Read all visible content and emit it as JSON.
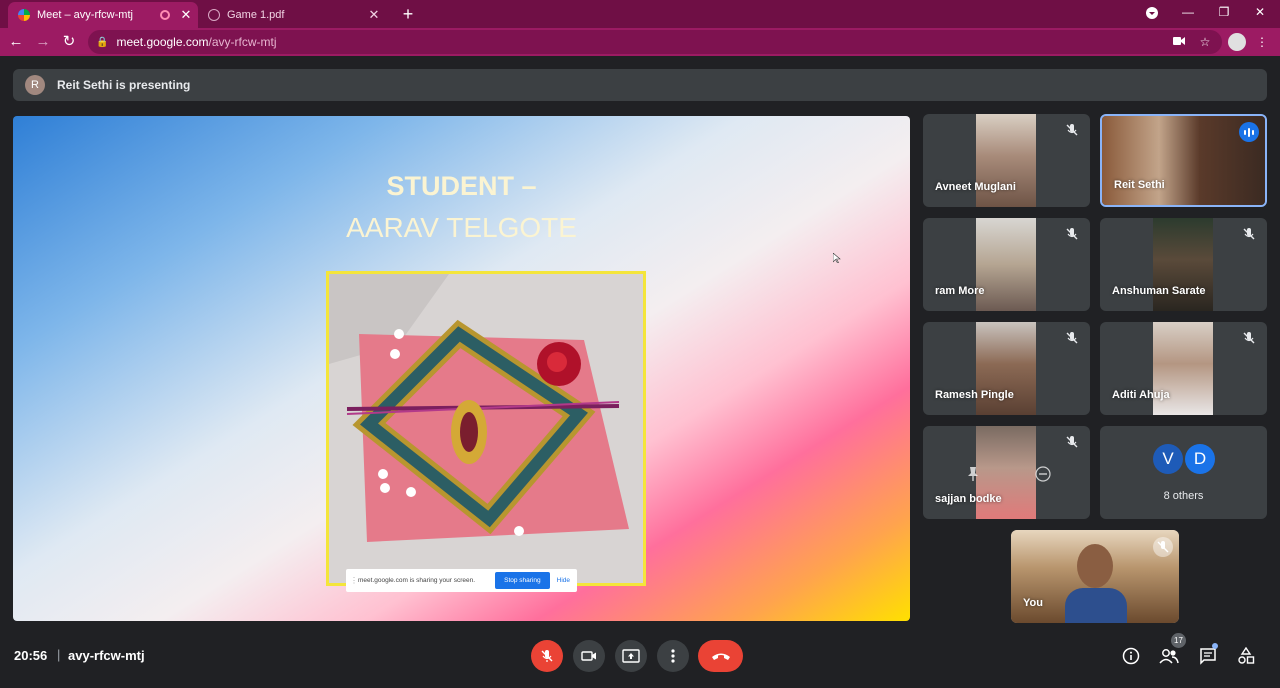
{
  "browser": {
    "tabs": [
      {
        "title": "Meet – avy-rfcw-mtj"
      },
      {
        "title": "Game 1.pdf"
      }
    ],
    "url_host": "meet.google.com",
    "url_path": "/avy-rfcw-mtj"
  },
  "banner": {
    "avatar_letter": "R",
    "text": "Reit Sethi is presenting"
  },
  "slide": {
    "title_line1": "STUDENT –",
    "title_line2": "AARAV TELGOTE"
  },
  "share_bar": {
    "message": "meet.google.com is sharing your screen.",
    "stop_label": "Stop sharing",
    "hide_label": "Hide"
  },
  "participants": [
    {
      "name": "Avneet Muglani",
      "muted": true
    },
    {
      "name": "Reit Sethi",
      "speaking": true
    },
    {
      "name": "ram More",
      "muted": true
    },
    {
      "name": "Anshuman Sarate",
      "muted": true
    },
    {
      "name": "Ramesh Pingle",
      "muted": true
    },
    {
      "name": "Aditi Ahuja",
      "muted": true
    },
    {
      "name": "sajjan bodke",
      "muted": true
    }
  ],
  "others": {
    "avatars": [
      {
        "letter": "V",
        "color": "#1e5bb8"
      },
      {
        "letter": "D",
        "color": "#1a73e8"
      }
    ],
    "label": "8 others"
  },
  "self_tile": {
    "name": "You"
  },
  "meeting": {
    "time": "20:56",
    "separator": "|",
    "code": "avy-rfcw-mtj",
    "people_count": "17"
  },
  "colors": {
    "tab_strip": "#6f0f45",
    "toolbar": "#9c1b63",
    "meet_bg": "#202124",
    "tile_bg": "#3c4043",
    "danger": "#ea4335",
    "accent": "#1a73e8"
  }
}
